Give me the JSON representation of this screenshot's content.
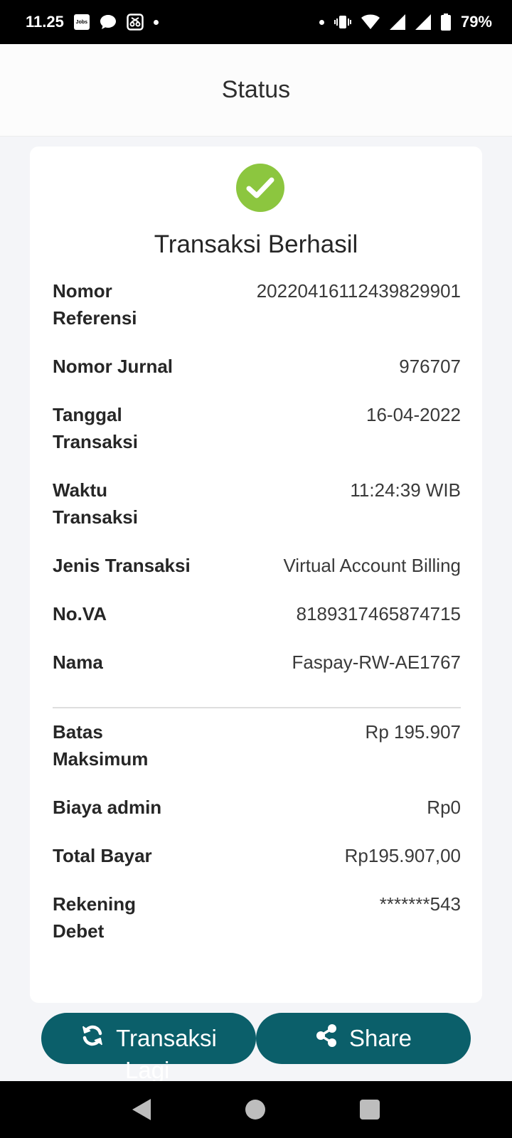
{
  "status_bar": {
    "time": "11.25",
    "app_badge": "Jobs",
    "battery": "79%"
  },
  "header": {
    "title": "Status"
  },
  "card": {
    "title": "Transaksi Berhasil",
    "details": [
      {
        "label": "Nomor Referensi",
        "value": "20220416112439829901"
      },
      {
        "label": "Nomor Jurnal",
        "value": "976707"
      },
      {
        "label": "Tanggal Transaksi",
        "value": "16-04-2022"
      },
      {
        "label": "Waktu Transaksi",
        "value": "11:24:39 WIB"
      },
      {
        "label": "Jenis Transaksi",
        "value": "Virtual Account Billing"
      },
      {
        "label": "No.VA",
        "value": "8189317465874715"
      },
      {
        "label": "Nama",
        "value": "Faspay-RW-AE1767"
      }
    ],
    "summary": [
      {
        "label": "Batas Maksimum",
        "value": "Rp 195.907"
      },
      {
        "label": "Biaya admin",
        "value": "Rp0"
      },
      {
        "label": "Total Bayar",
        "value": "Rp195.907,00"
      },
      {
        "label": "Rekening Debet",
        "value": "*******543"
      }
    ]
  },
  "buttons": {
    "transaksi_label": "Transaksi",
    "transaksi_overflow": "Lagi",
    "share_label": "Share"
  },
  "colors": {
    "success": "#8cc63f",
    "primary": "#0b5f6a"
  }
}
